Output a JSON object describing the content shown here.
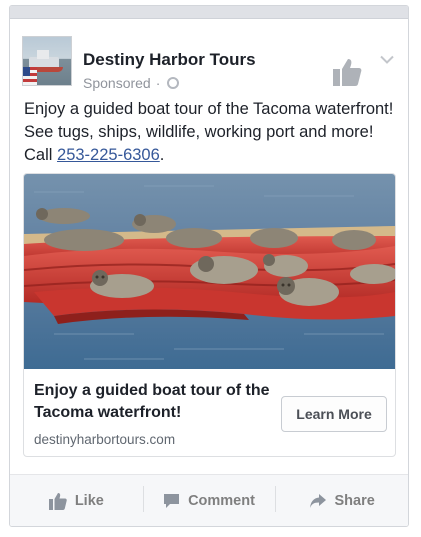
{
  "post": {
    "page_name": "Destiny Harbor Tours",
    "sponsored_label": "Sponsored",
    "separator": "·",
    "text_before_phone": "Enjoy a guided boat tour of the Tacoma waterfront! See tugs, ships, wildlife, working port and more! Call ",
    "phone": "253-225-6306",
    "text_after_phone": "."
  },
  "attachment": {
    "title": "Enjoy a guided boat tour of the Tacoma waterfront!",
    "domain": "destinyharbortours.com",
    "cta_label": "Learn More"
  },
  "actions": {
    "like_label": "Like",
    "comment_label": "Comment",
    "share_label": "Share"
  },
  "icons": {
    "globe": "globe-icon",
    "like_page": "thumbs-up-icon",
    "chevron": "chevron-down-icon",
    "comment": "comment-icon",
    "share": "share-icon"
  },
  "colors": {
    "link": "#365899",
    "text": "#1d2129",
    "muted": "#90949c",
    "action_text": "#7f7f7f"
  }
}
